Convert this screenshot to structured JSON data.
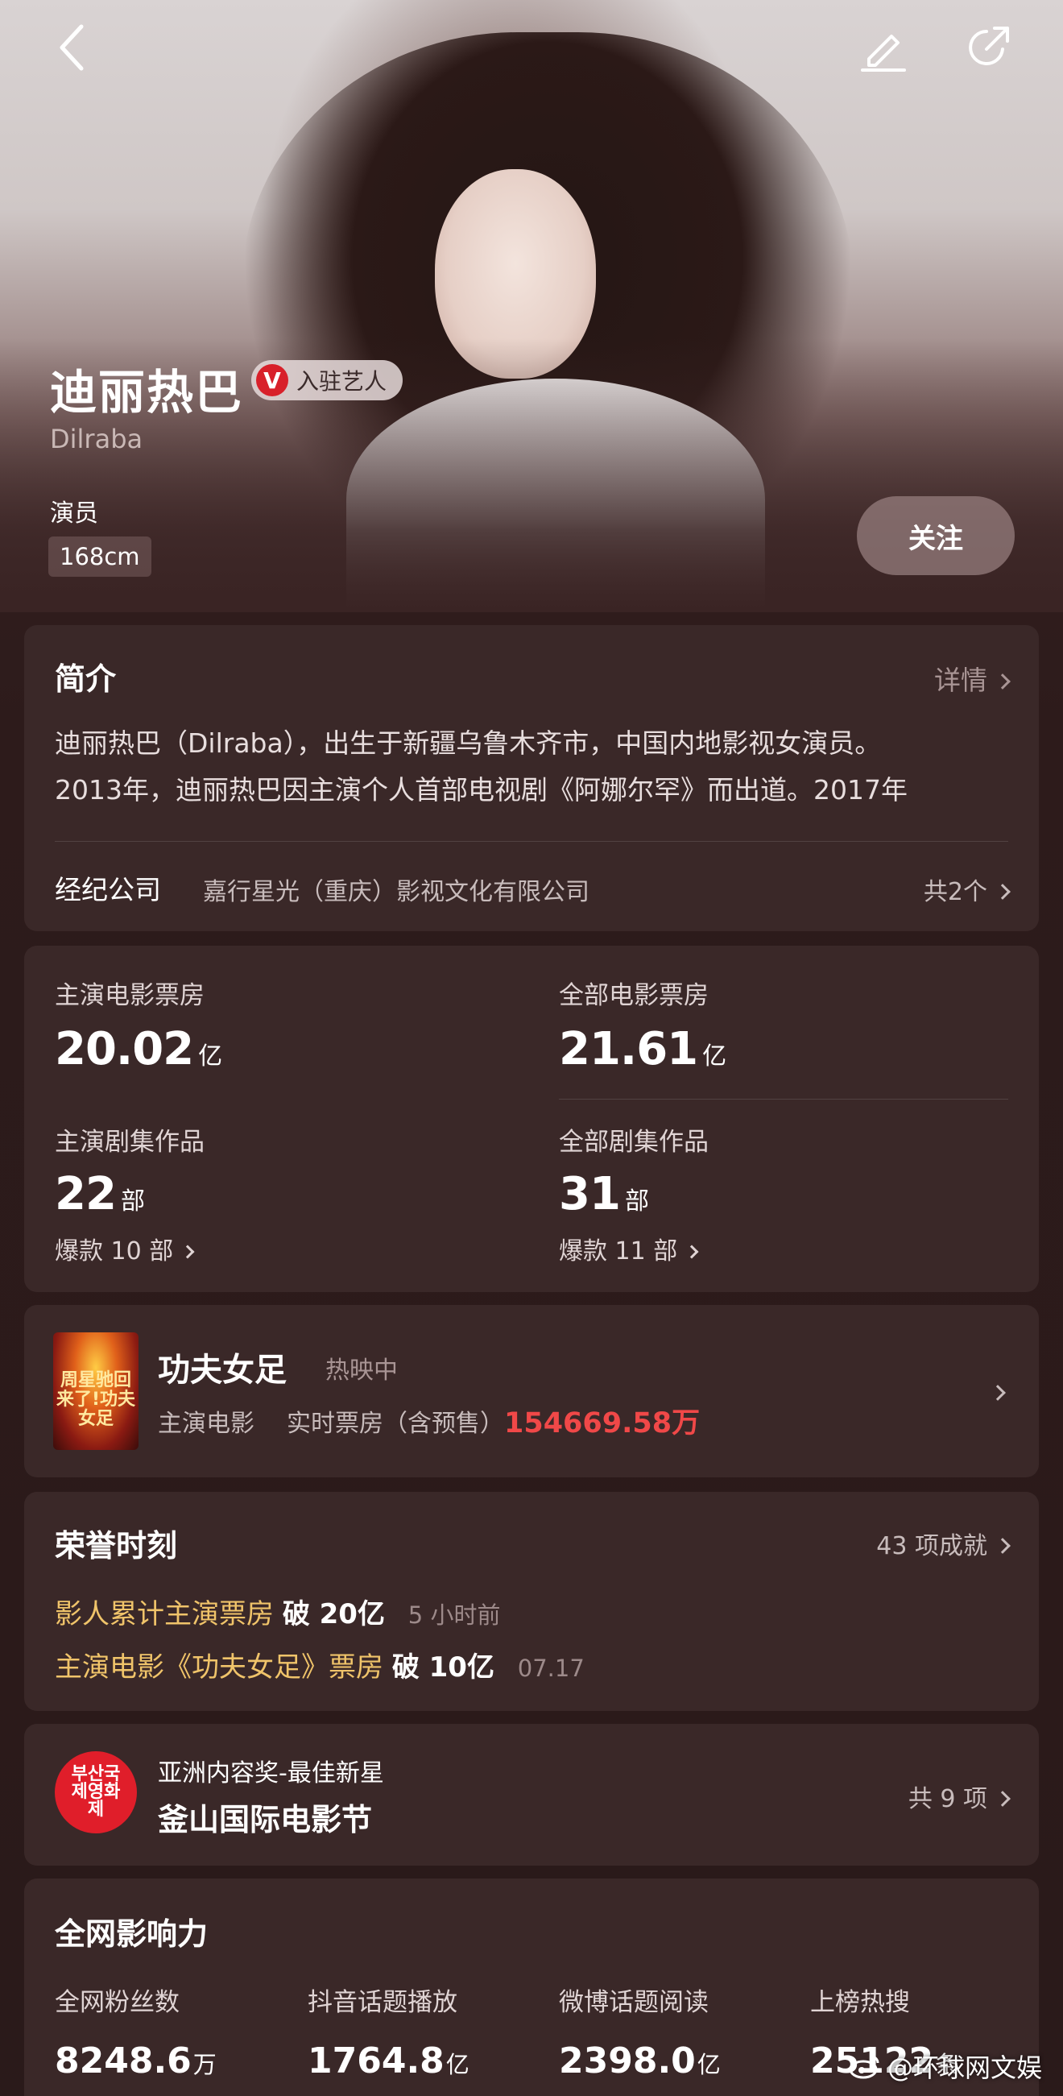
{
  "header": {
    "back_icon": "back-arrow-icon",
    "edit_icon": "edit-pencil-icon",
    "share_icon": "share-icon"
  },
  "profile": {
    "name": "迪丽热巴",
    "badge_mark": "V",
    "badge_label": "入驻艺人",
    "alias": "Dilraba",
    "role": "演员",
    "height": "168cm",
    "follow_label": "关注"
  },
  "intro": {
    "title": "简介",
    "detail_link": "详情",
    "line1": "迪丽热巴（Dilraba），出生于新疆乌鲁木齐市，中国内地影视女演员。",
    "line2": "2013年，迪丽热巴因主演个人首部电视剧《阿娜尔罕》而出道。2017年",
    "agency_label": "经纪公司",
    "agency_name": "嘉行星光（重庆）影视文化有限公司",
    "agency_count": "共2个"
  },
  "stats": {
    "lead_box_office_label": "主演电影票房",
    "lead_box_office_value": "20.02",
    "lead_box_office_unit": "亿",
    "all_box_office_label": "全部电影票房",
    "all_box_office_value": "21.61",
    "all_box_office_unit": "亿",
    "lead_series_label": "主演剧集作品",
    "lead_series_value": "22",
    "lead_series_unit": "部",
    "lead_series_hits": "爆款 10 部",
    "all_series_label": "全部剧集作品",
    "all_series_value": "31",
    "all_series_unit": "部",
    "all_series_hits": "爆款 11 部"
  },
  "movie": {
    "poster_text": "周星驰回来了!功夫女足",
    "title": "功夫女足",
    "status": "热映中",
    "role_label": "主演电影",
    "box_office_label": "实时票房（含预售）",
    "box_office_value": "154669.58万",
    "accent_color": "#f04848"
  },
  "honors": {
    "title": "荣誉时刻",
    "count_label": "43 项成就",
    "items": [
      {
        "prefix": "影人累计主演票房",
        "highlight": "破 20亿",
        "time": "5 小时前"
      },
      {
        "prefix": "主演电影《功夫女足》票房",
        "highlight": "破 10亿",
        "time": "07.17"
      }
    ]
  },
  "festival": {
    "logo_text": "부산국제영화제",
    "award": "亚洲内容奖-最佳新星",
    "name": "釜山国际电影节",
    "count_label": "共 9 项"
  },
  "influence": {
    "title": "全网影响力",
    "items": [
      {
        "label": "全网粉丝数",
        "value": "8248.6",
        "unit": "万"
      },
      {
        "label": "抖音话题播放",
        "value": "1764.8",
        "unit": "亿"
      },
      {
        "label": "微博话题阅读",
        "value": "2398.0",
        "unit": "亿"
      },
      {
        "label": "上榜热搜",
        "value": "25122",
        "unit": "条"
      }
    ]
  },
  "watermark": {
    "text": "@环球网文娱",
    "icon": "weibo-icon"
  }
}
